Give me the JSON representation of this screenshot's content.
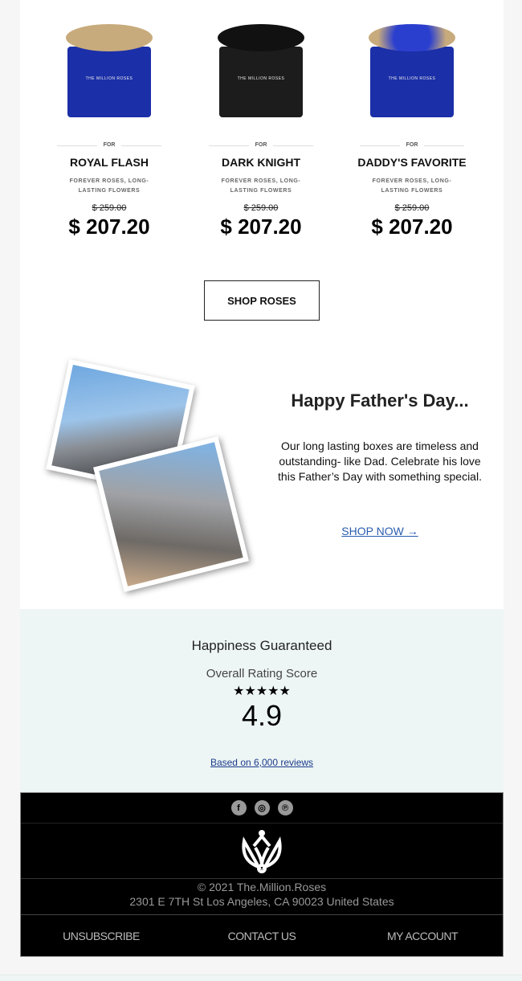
{
  "products": [
    {
      "label": "FOR",
      "name": "ROYAL FLASH",
      "desc": "FOREVER ROSES, LONG-LASTING FLOWERS",
      "old_price": "$ 259.00",
      "price": "$ 207.20",
      "box_color": "#1b2fa8",
      "rose_color": "#c8ab7c",
      "brand": "THE MILLION ROSES"
    },
    {
      "label": "FOR",
      "name": "DARK KNIGHT",
      "desc": "FOREVER ROSES, LONG-LASTING FLOWERS",
      "old_price": "$ 259.00",
      "price": "$ 207.20",
      "box_color": "#1c1c1c",
      "rose_color": "#111111",
      "brand": "THE MILLION ROSES"
    },
    {
      "label": "FOR",
      "name": "DADDY'S FAVORITE",
      "desc": "FOREVER ROSES, LONG-LASTING FLOWERS",
      "old_price": "$ 259.00",
      "price": "$ 207.20",
      "box_color": "#1b2fa8",
      "rose_color": "#2b3fcf",
      "brand": "THE MILLION ROSES"
    }
  ],
  "shop_roses": "SHOP ROSES",
  "fathers_day": {
    "title": "Happy Father's Day...",
    "body": "Our long lasting boxes are timeless and outstanding- like Dad. Celebrate his love this Father’s Day with something special.",
    "link": "SHOP NOW →"
  },
  "rating": {
    "title": "Happiness Guaranteed",
    "subtitle": "Overall Rating Score",
    "stars": "★★★★★",
    "score": "4.9",
    "reviews": "Based on 6,000 reviews",
    "stars_value": 5
  },
  "footer": {
    "social": [
      "f",
      "◎",
      "℗"
    ],
    "copyright": "© 2021 The.Million.Roses",
    "address": "2301 E 7TH St Los Angeles, CA 90023 United States",
    "links": [
      "UNSUBSCRIBE",
      "CONTACT US",
      "MY ACCOUNT"
    ]
  }
}
